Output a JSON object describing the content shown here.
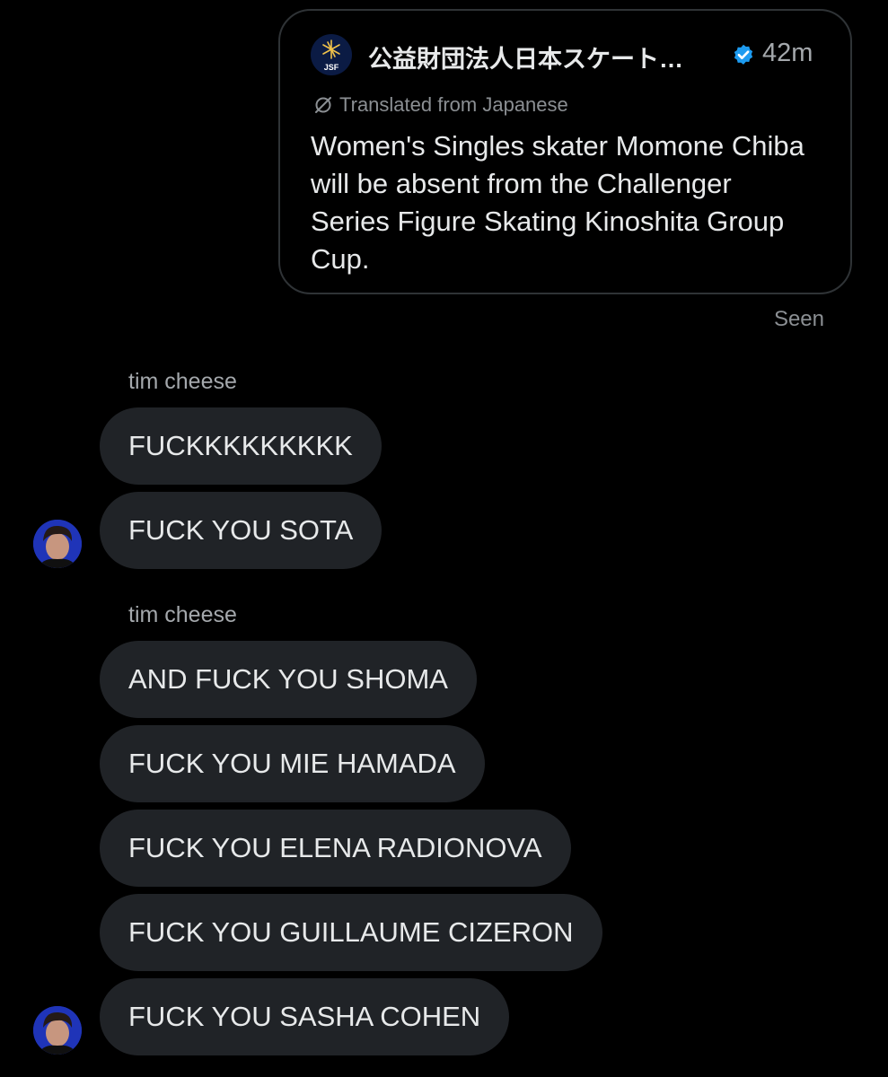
{
  "shared_post": {
    "author_name": "公益財団法人日本スケート…",
    "avatar_text": "JSF",
    "time": "42m",
    "translated_label": "Translated from Japanese",
    "text": "Women's Singles skater Momone Chiba will be absent from the Challenger Series Figure Skating Kinoshita Group Cup.",
    "badge_color": "#1d9bf0",
    "icons": {
      "verified": "verified-badge-icon",
      "translate": "translate-icon"
    }
  },
  "receipt": {
    "seen": "Seen"
  },
  "groups": [
    {
      "sender": "tim cheese",
      "messages": [
        "FUCKKKKKKKKK",
        "FUCK YOU SOTA"
      ]
    },
    {
      "sender": "tim cheese",
      "messages": [
        "AND FUCK YOU SHOMA",
        "FUCK YOU MIE HAMADA",
        "FUCK YOU ELENA RADIONOVA",
        "FUCK YOU GUILLAUME CIZERON",
        "FUCK YOU SASHA COHEN"
      ]
    }
  ],
  "colors": {
    "background": "#000000",
    "bubble": "#202327",
    "text": "#e7e9ea",
    "muted": "#8b8f93",
    "card_border": "#2f3336"
  }
}
